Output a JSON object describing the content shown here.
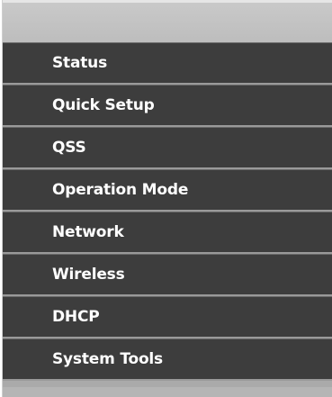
{
  "menu": {
    "items": [
      {
        "label": "Status"
      },
      {
        "label": "Quick Setup"
      },
      {
        "label": "QSS"
      },
      {
        "label": "Operation Mode"
      },
      {
        "label": "Network"
      },
      {
        "label": "Wireless"
      },
      {
        "label": "DHCP"
      },
      {
        "label": "System Tools"
      }
    ]
  },
  "colors": {
    "item_background": "#3d3d3d",
    "item_text": "#ffffff",
    "panel_background": "#aaaaaa",
    "header_background": "#bdbdbd"
  }
}
